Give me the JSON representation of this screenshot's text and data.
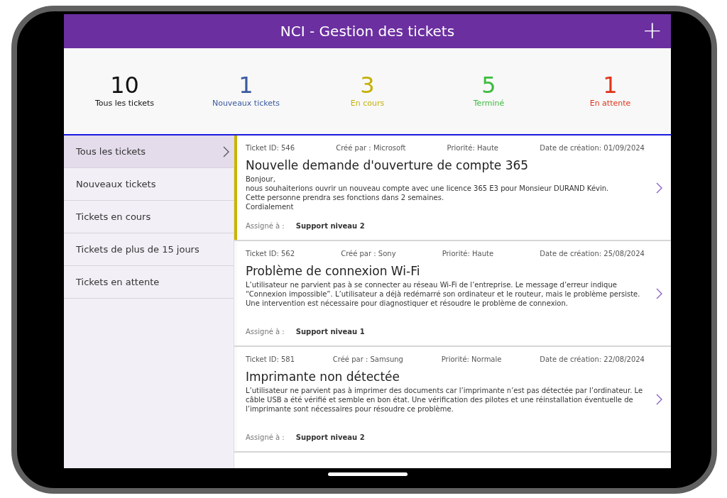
{
  "header": {
    "title": "NCI - Gestion des tickets",
    "add_button": "+"
  },
  "stats": [
    {
      "count": "10",
      "label": "Tous les tickets",
      "color": "#111111"
    },
    {
      "count": "1",
      "label": "Nouveaux tickets",
      "color": "#3b5aa0"
    },
    {
      "count": "3",
      "label": "En cours",
      "color": "#c4b000"
    },
    {
      "count": "5",
      "label": "Terminé",
      "color": "#3dbb3d"
    },
    {
      "count": "1",
      "label": "En attente",
      "color": "#e0341a"
    }
  ],
  "sidebar": {
    "items": [
      {
        "label": "Tous les tickets",
        "selected": true
      },
      {
        "label": "Nouveaux tickets",
        "selected": false
      },
      {
        "label": "Tickets en cours",
        "selected": false
      },
      {
        "label": "Tickets de plus de 15 jours",
        "selected": false
      },
      {
        "label": "Tickets en attente",
        "selected": false
      }
    ]
  },
  "tickets": [
    {
      "selected": true,
      "id": "Ticket ID: 546",
      "created_by": "Créé par : Microsoft",
      "priority": "Priorité: Haute",
      "date": "Date de création: 01/09/2024",
      "title": "Nouvelle demande d'ouverture de compte 365",
      "description": [
        "Bonjour,",
        "nous souhaiterions ouvrir un nouveau compte avec une licence 365 E3 pour Monsieur DURAND Kévin.",
        "Cette personne prendra ses fonctions dans 2 semaines.",
        "Cordialement"
      ],
      "assigned_label": "Assigné à :",
      "assigned_to": "Support niveau 2"
    },
    {
      "selected": false,
      "id": "Ticket ID: 562",
      "created_by": "Créé par : Sony",
      "priority": "Priorité: Haute",
      "date": "Date de création: 25/08/2024",
      "title": "Problème de connexion Wi-Fi",
      "description": [
        "L’utilisateur ne parvient pas à se connecter au réseau Wi-Fi de l’entreprise. Le message d’erreur indique “Connexion impossible”. L’utilisateur a déjà redémarré son ordinateur et le routeur, mais le problème persiste. Une intervention est nécessaire pour diagnostiquer et résoudre le problème de connexion."
      ],
      "assigned_label": "Assigné à :",
      "assigned_to": "Support niveau 1"
    },
    {
      "selected": false,
      "id": "Ticket ID: 581",
      "created_by": "Créé par : Samsung",
      "priority": "Priorité: Normale",
      "date": "Date de création: 22/08/2024",
      "title": "Imprimante non détectée",
      "description": [
        "L’utilisateur ne parvient pas à imprimer des documents car l’imprimante n’est pas détectée par l’ordinateur. Le câble USB a été vérifié et semble en bon état. Une vérification des pilotes et une réinstallation éventuelle de l’imprimante sont nécessaires pour résoudre ce problème."
      ],
      "assigned_label": "Assigné à :",
      "assigned_to": "Support niveau 2"
    }
  ]
}
